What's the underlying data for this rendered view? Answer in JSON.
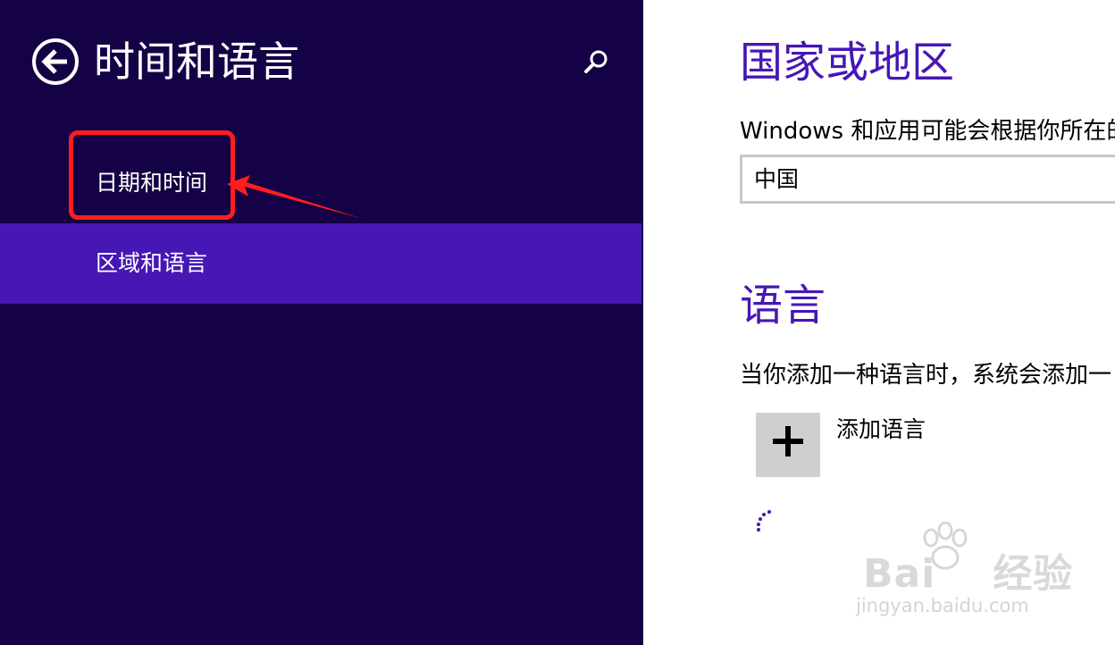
{
  "left_pane": {
    "title": "时间和语言",
    "nav_items": [
      {
        "label": "日期和时间",
        "selected": false
      },
      {
        "label": "区域和语言",
        "selected": true
      }
    ]
  },
  "right_pane": {
    "region_heading": "国家或地区",
    "region_description": "Windows 和应用可能会根据你所在的",
    "country_value": "中国",
    "language_heading": "语言",
    "language_description": "当你添加一种语言时，系统会添加一",
    "add_language_label": "添加语言"
  },
  "watermark": {
    "brand": "Bai",
    "brand_suffix": "经验",
    "url": "jingyan.baidu.com"
  },
  "colors": {
    "pane_background": "#150145",
    "accent": "#4617b4",
    "annotation": "#ff1e1e"
  },
  "icons": [
    "back-arrow-icon",
    "search-icon",
    "plus-icon",
    "loading-spinner-icon"
  ]
}
